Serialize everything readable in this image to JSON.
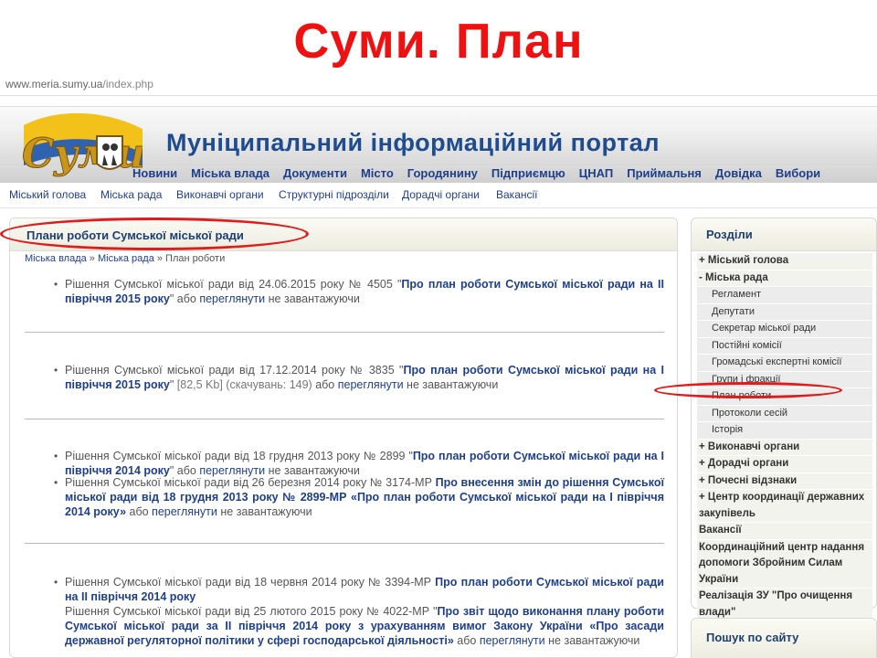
{
  "slide": {
    "title": "Суми. План"
  },
  "browser": {
    "url_domain": "www.meria.sumy.ua",
    "url_path": "/index.php"
  },
  "header": {
    "portal_title": "Муніципальний інформаційний портал",
    "logo": "sumy-coat-of-arms-logo",
    "logo_text": "Суми",
    "nav": [
      "Новини",
      "Міська влада",
      "Документи",
      "Місто",
      "Городянину",
      "Підприємцю",
      "ЦНАП",
      "Приймальня",
      "Довідка",
      "Вибори"
    ]
  },
  "subnav": [
    "Міський голова",
    "Міська рада",
    "Виконавчі органи",
    "Структурні підрозділи",
    "Дорадчі органи",
    "Вакансії"
  ],
  "main": {
    "title": "Плани роботи Сумської міської ради",
    "breadcrumb": [
      "Міська влада",
      "Міська рада",
      "План роботи"
    ],
    "breadcrumb_sep": " » ",
    "docs": [
      {
        "items": [
          {
            "prefix": "Рішення Сумської міської ради від 24.06.2015 року № 4505 \"",
            "link": "Про план роботи Сумської міської ради на ІІ півріччя 2015 року",
            "suffix": "\" або ",
            "view": "переглянути",
            "tail": " не завантажуючи"
          }
        ]
      },
      {
        "items": [
          {
            "prefix": "Рішення Сумської міської ради від 17.12.2014 року № 3835 \"",
            "link": "Про план роботи Сумської міської ради на І півріччя 2015 року",
            "suffix": "\" ",
            "meta": "[82,5 Kb] (скачувань: 149)",
            "after_meta": " або ",
            "view": "переглянути",
            "tail": " не завантажуючи"
          }
        ]
      },
      {
        "items": [
          {
            "prefix": "Рішення Сумської міської ради від 18 грудня 2013 року № 2899 \"",
            "link": "Про план роботи Сумської міської ради на І півріччя 2014 року",
            "suffix": "\"  або ",
            "view": "переглянути",
            "tail": " не завантажуючи"
          },
          {
            "prefix": "Рішення Сумської міської ради від 26 березня 2014 року № 3174-МР ",
            "link": "Про внесення змін до рішення Сумської міської ради від 18 грудня 2013 року № 2899-МР «Про план роботи Сумської міської ради на І півріччя 2014 року»",
            "suffix": "  або ",
            "view": "переглянути",
            "tail": " не завантажуючи"
          }
        ]
      },
      {
        "items": [
          {
            "prefix": "Рішення Сумської міської ради від 18 червня 2014 року № 3394-МР ",
            "link": "Про план роботи Сумської міської ради на ІІ півріччя 2014 року",
            "suffix": "",
            "view": "",
            "tail": ""
          },
          {
            "prefix": "Рішення Сумської міської ради від 25 лютого 2015 року № 4022-МР \"",
            "link": "Про звіт щодо виконання плану роботи Сумської міської ради за ІІ півріччя 2014 року з урахуванням вимог Закону України «Про засади державної регуляторної політики у сфері господарської діяльності»",
            "suffix": " або ",
            "view": "переглянути",
            "tail": " не завантажуючи"
          }
        ]
      }
    ]
  },
  "sidebar": {
    "title": "Розділи",
    "items": [
      {
        "type": "top",
        "label": "+ Міський голова"
      },
      {
        "type": "top",
        "label": "- Міська рада"
      },
      {
        "type": "sub",
        "label": "Регламент"
      },
      {
        "type": "sub",
        "label": "Депутати"
      },
      {
        "type": "sub",
        "label": "Секретар міської ради"
      },
      {
        "type": "sub",
        "label": "Постійні комісії"
      },
      {
        "type": "sub",
        "label": "Громадські експертні комісії"
      },
      {
        "type": "sub",
        "label": "Групи і фракції"
      },
      {
        "type": "sub",
        "label": "План роботи",
        "highlight": true
      },
      {
        "type": "sub",
        "label": "Протоколи сесій"
      },
      {
        "type": "sub",
        "label": "Історія"
      },
      {
        "type": "top",
        "label": "+ Виконавчі органи"
      },
      {
        "type": "top",
        "label": "+ Дорадчі органи"
      },
      {
        "type": "top",
        "label": "+ Почесні відзнаки"
      },
      {
        "type": "top",
        "label": "+ Центр координації державних закупівель"
      },
      {
        "type": "top",
        "label": "Вакансії"
      },
      {
        "type": "top",
        "label": "Координаційний центр надання допомоги Збройним Силам України"
      },
      {
        "type": "top",
        "label": "Реалізація ЗУ \"Про очищення влади\""
      }
    ]
  },
  "search": {
    "title": "Пошук по сайту"
  },
  "colors": {
    "title_red": "#ee1111",
    "link_blue": "#1f3f8a",
    "annotation_red": "#e11a1a"
  }
}
